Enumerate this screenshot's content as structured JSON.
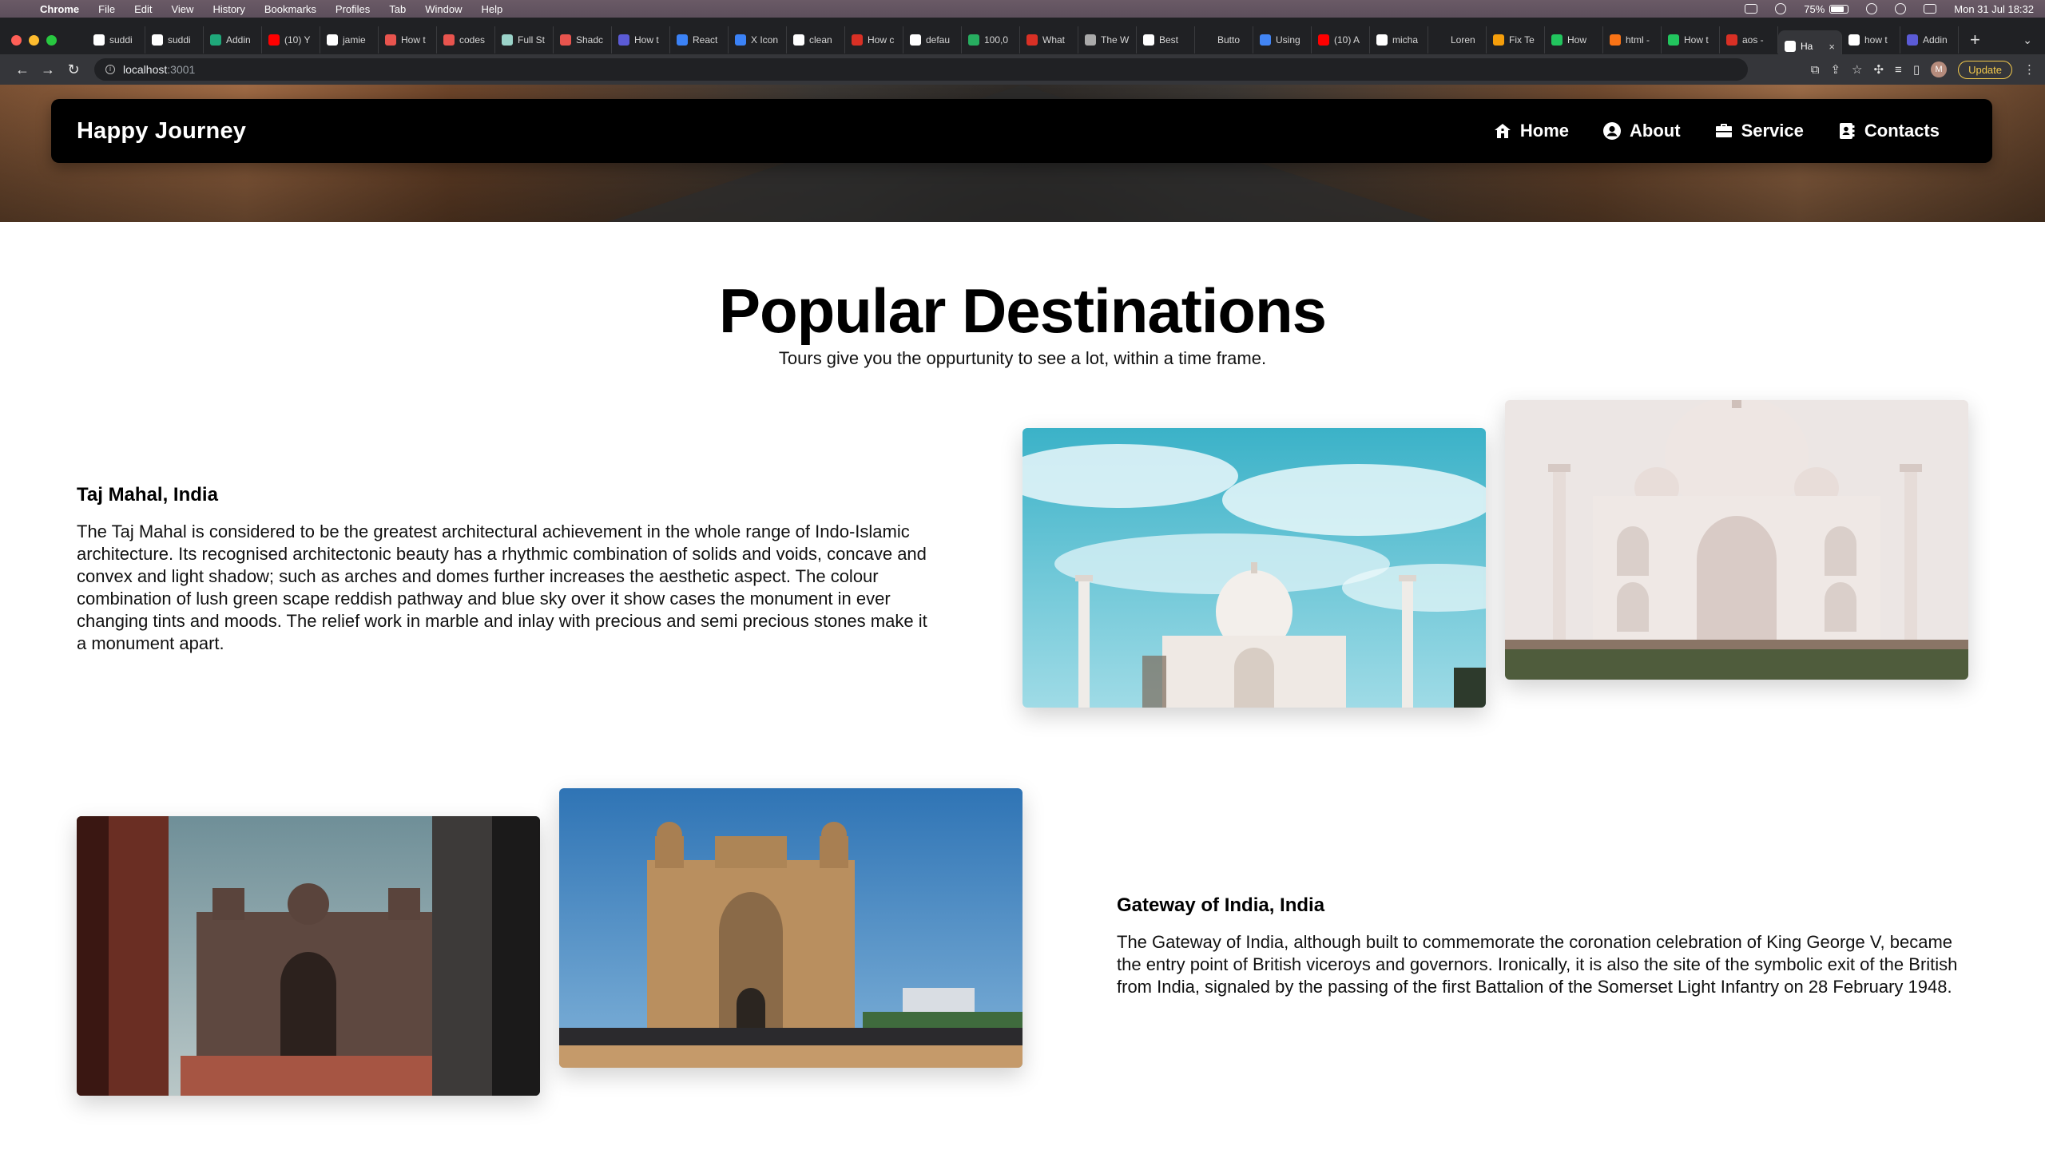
{
  "os_menubar": {
    "app": "Chrome",
    "menus": [
      "File",
      "Edit",
      "View",
      "History",
      "Bookmarks",
      "Profiles",
      "Tab",
      "Window",
      "Help"
    ],
    "battery": "75%",
    "datetime": "Mon 31 Jul  18:32"
  },
  "browser": {
    "tabs": [
      {
        "label": "suddi",
        "color": "#ffffff"
      },
      {
        "label": "suddi",
        "color": "#ffffff"
      },
      {
        "label": "Addin",
        "color": "#1fa87a"
      },
      {
        "label": "(10) Y",
        "color": "#ff0000"
      },
      {
        "label": "jamie",
        "color": "#ffffff"
      },
      {
        "label": "How t",
        "color": "#e8544e"
      },
      {
        "label": "codes",
        "color": "#e8544e"
      },
      {
        "label": "Full St",
        "color": "#9bd3c9"
      },
      {
        "label": "Shadc",
        "color": "#e8544e"
      },
      {
        "label": "How t",
        "color": "#5b5bd6"
      },
      {
        "label": "React",
        "color": "#3b82f6"
      },
      {
        "label": "X Icon",
        "color": "#3b82f6"
      },
      {
        "label": "clean",
        "color": "#ffffff"
      },
      {
        "label": "How c",
        "color": "#d93025"
      },
      {
        "label": "defau",
        "color": "#ffffff"
      },
      {
        "label": "100,0",
        "color": "#27ae60"
      },
      {
        "label": "What",
        "color": "#d93025"
      },
      {
        "label": "The W",
        "color": "#aaaaaa"
      },
      {
        "label": "Best",
        "color": "#ffffff"
      },
      {
        "label": "Butto",
        "color": "#202124"
      },
      {
        "label": "Using",
        "color": "#4285f4"
      },
      {
        "label": "(10) A",
        "color": "#ff0000"
      },
      {
        "label": "micha",
        "color": "#ffffff"
      },
      {
        "label": "Loren",
        "color": "#202124"
      },
      {
        "label": "Fix Te",
        "color": "#f59e0b"
      },
      {
        "label": "How",
        "color": "#22c55e"
      },
      {
        "label": "html -",
        "color": "#f97316"
      },
      {
        "label": "How t",
        "color": "#22c55e"
      },
      {
        "label": "aos -",
        "color": "#d93025"
      },
      {
        "label": "Ha",
        "color": "#ffffff",
        "active": true
      },
      {
        "label": "how t",
        "color": "#ffffff"
      },
      {
        "label": "Addin",
        "color": "#5b5bd6"
      }
    ],
    "url_host": "localhost",
    "url_port": ":3001",
    "update_label": "Update",
    "profile_initial": "M"
  },
  "site": {
    "brand": "Happy Journey",
    "nav": [
      {
        "label": "Home",
        "icon": "house-icon"
      },
      {
        "label": "About",
        "icon": "user-circle-icon"
      },
      {
        "label": "Service",
        "icon": "briefcase-icon"
      },
      {
        "label": "Contacts",
        "icon": "address-book-icon"
      }
    ],
    "heading": "Popular Destinations",
    "subheading": "Tours give you the oppurtunity to see a lot, within a time frame.",
    "destinations": [
      {
        "title": "Taj Mahal, India",
        "description": "The Taj Mahal is considered to be the greatest architectural achievement in the whole range of Indo-Islamic architecture. Its recognised architectonic beauty has a rhythmic combination of solids and voids, concave and convex and light shadow; such as arches and domes further increases the aesthetic aspect. The colour combination of lush green scape reddish pathway and blue sky over it show cases the monument in ever changing tints and moods. The relief work in marble and inlay with precious and semi precious stones make it a monument apart.",
        "photos": [
          "taj-mahal-sky-photo",
          "taj-mahal-front-photo"
        ]
      },
      {
        "title": "Gateway of India, India",
        "description": "The Gateway of India, although built to commemorate the coronation celebration of King George V, became the entry point of British viceroys and governors. Ironically, it is also the site of the symbolic exit of the British from India, signaled by the passing of the first Battalion of the Somerset Light Infantry on 28 February 1948.",
        "photos": [
          "gateway-framed-photo",
          "gateway-front-photo"
        ]
      }
    ]
  },
  "colors": {
    "navbar_bg": "#000000",
    "page_bg": "#ffffff",
    "text": "#111111"
  }
}
